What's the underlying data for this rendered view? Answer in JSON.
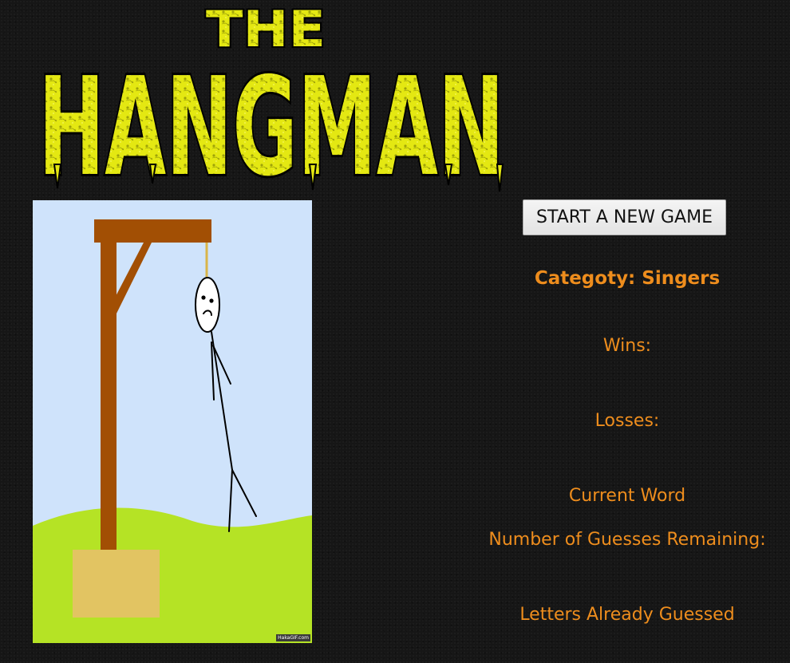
{
  "logo": {
    "line1": "THE",
    "line2": "HANGMAN",
    "color": "#e8ec12"
  },
  "scene": {
    "watermark": "HakaGIF.com",
    "sky_color": "#cfe3fb",
    "grass_color": "#b5e325",
    "wood_color": "#a24f04",
    "box_color": "#e2c462"
  },
  "panel": {
    "new_game_label": "START A NEW GAME",
    "category": "Categoty: Singers",
    "wins_label": "Wins:",
    "losses_label": "Losses:",
    "current_word_label": "Current Word",
    "guesses_remaining_label": "Number of Guesses Remaining:",
    "letters_guessed_label": "Letters Already Guessed",
    "text_color": "#ee8d1d"
  }
}
